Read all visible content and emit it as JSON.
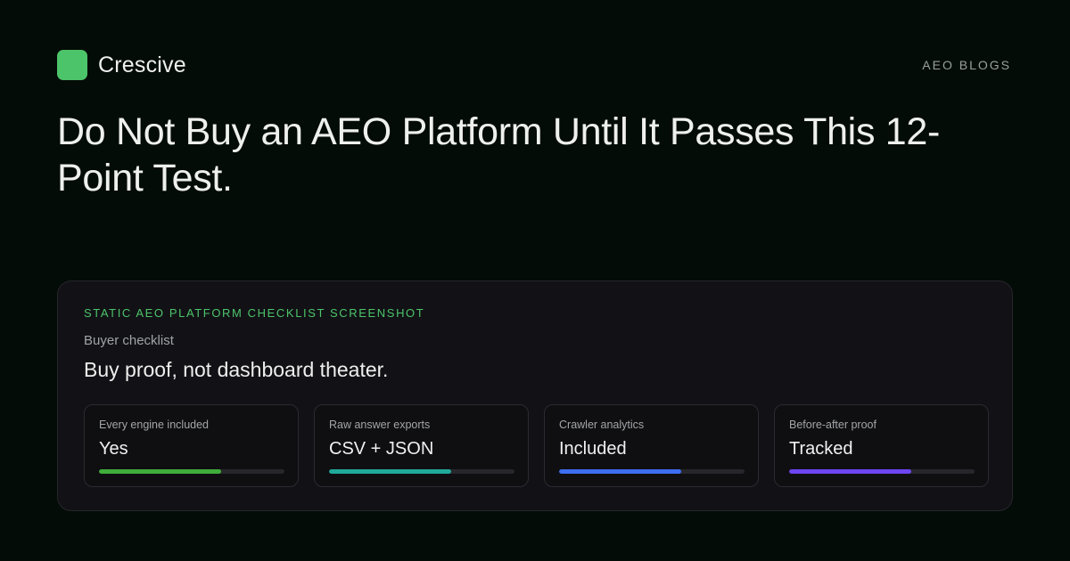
{
  "brand": {
    "name": "Crescive",
    "logo_color": "#4cc46a"
  },
  "nav": {
    "section_label": "AEO BLOGS"
  },
  "headline": "Do Not Buy an AEO Platform Until It Passes This 12-Point Test.",
  "panel": {
    "eyebrow": "STATIC AEO PLATFORM CHECKLIST SCREENSHOT",
    "subhead": "Buyer checklist",
    "title": "Buy proof, not dashboard theater.",
    "cards": [
      {
        "label": "Every engine included",
        "value": "Yes",
        "progress_percent": 66,
        "color": "#3fae3b"
      },
      {
        "label": "Raw answer exports",
        "value": "CSV + JSON",
        "progress_percent": 66,
        "color": "#1fa99a"
      },
      {
        "label": "Crawler analytics",
        "value": "Included",
        "progress_percent": 66,
        "color": "#3d6ef0"
      },
      {
        "label": "Before-after proof",
        "value": "Tracked",
        "progress_percent": 66,
        "color": "#6d45f2"
      }
    ]
  }
}
